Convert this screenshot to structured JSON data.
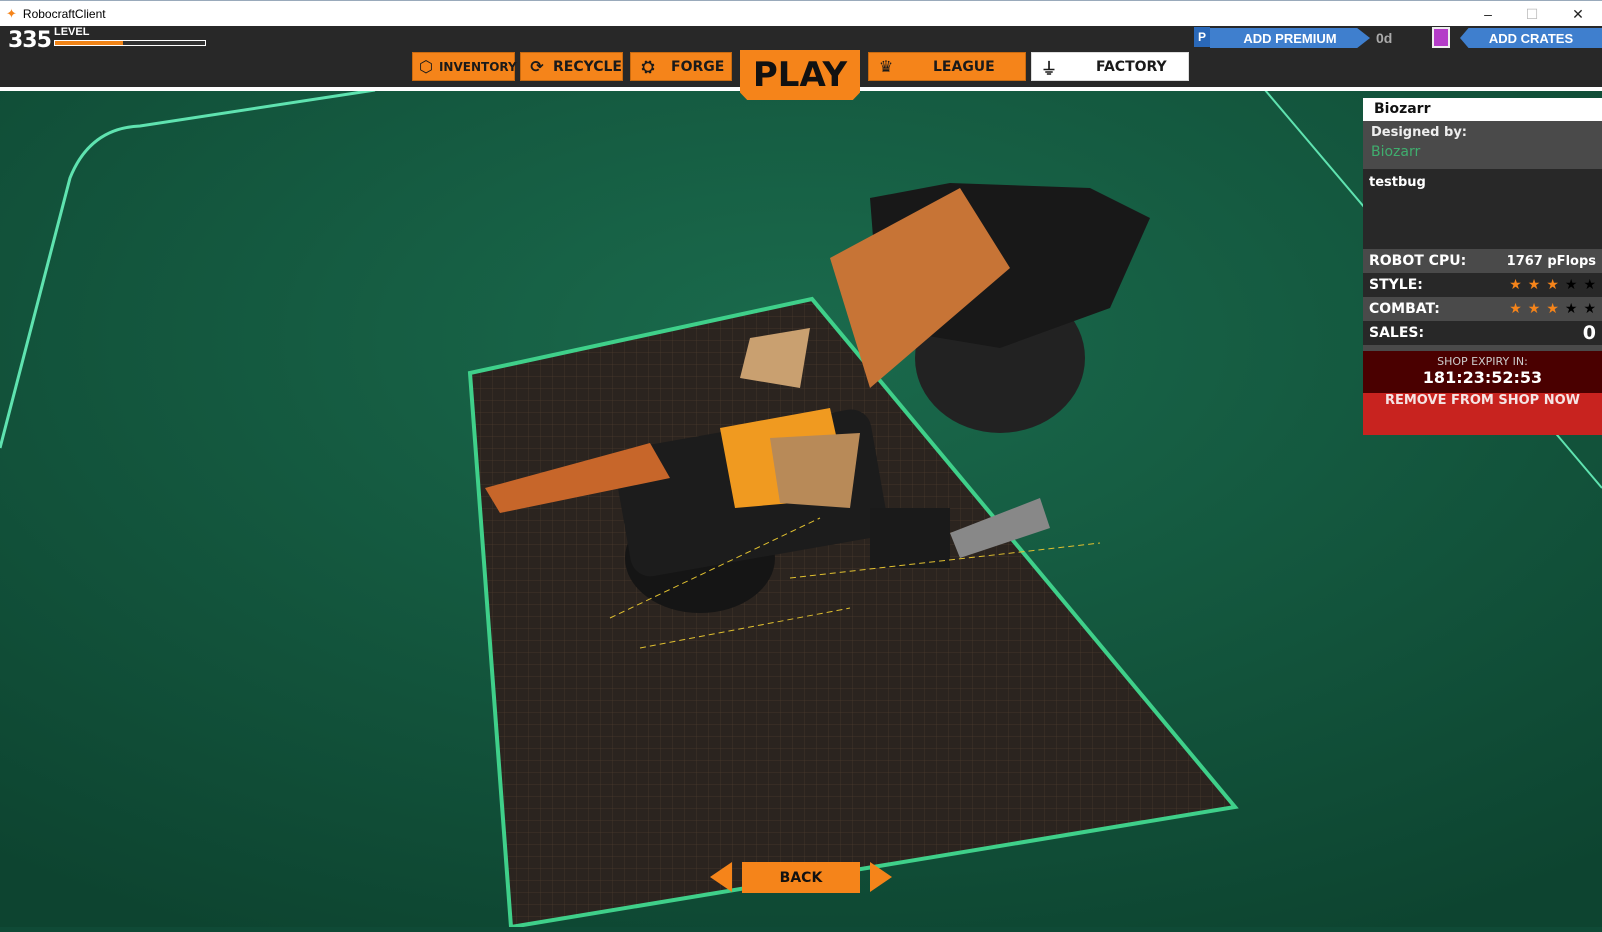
{
  "window": {
    "title": "RobocraftClient",
    "minimize": "–",
    "maximize": "☐",
    "close": "✕"
  },
  "player": {
    "level": "335",
    "level_label": "LEVEL",
    "level_progress": 0.45
  },
  "nav": {
    "inventory": "INVENTORY",
    "recycle": "RECYCLE",
    "forge": "FORGE",
    "play": "PLAY",
    "league": "LEAGUE",
    "factory": "FACTORY"
  },
  "premium": {
    "add_premium": "ADD PREMIUM",
    "days": "0d",
    "add_crates": "ADD CRATES"
  },
  "robot": {
    "name": "Biozarr",
    "designed_by_label": "Designed by:",
    "designer": "Biozarr",
    "description": "testbug",
    "cpu_label": "ROBOT CPU:",
    "cpu_value": "1767 pFlops",
    "style_label": "STYLE:",
    "style_rating": 3,
    "combat_label": "COMBAT:",
    "combat_rating": 3,
    "sales_label": "SALES:",
    "sales_value": "0",
    "expiry_label": "SHOP EXPIRY IN:",
    "expiry_value": "181:23:52:53",
    "remove_label": "REMOVE FROM SHOP NOW"
  },
  "footer": {
    "back": "BACK"
  },
  "colors": {
    "accent": "#f5841a",
    "premium": "#3f7fce",
    "danger": "#c8231f",
    "expiry_bg": "#4a0000",
    "designer": "#3fae6e"
  }
}
